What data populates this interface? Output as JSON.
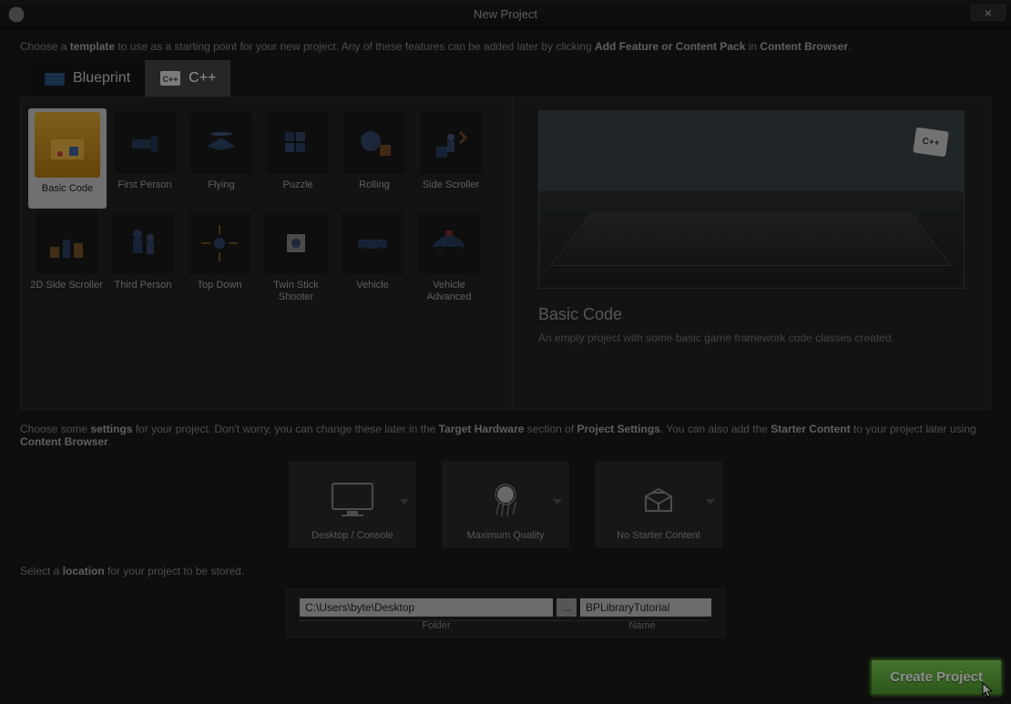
{
  "window": {
    "title": "New Project",
    "close": "×"
  },
  "hint1": {
    "prefix": "Choose a ",
    "bold1": "template",
    "mid": " to use as a starting point for your new project.  Any of these features can be added later by clicking ",
    "bold2": "Add Feature or Content Pack",
    "mid2": " in ",
    "bold3": "Content Browser",
    "end": "."
  },
  "tabs": {
    "blueprint": "Blueprint",
    "cpp": "C++"
  },
  "templates": [
    {
      "label": "Basic Code",
      "selected": true
    },
    {
      "label": "First Person"
    },
    {
      "label": "Flying"
    },
    {
      "label": "Puzzle"
    },
    {
      "label": "Rolling"
    },
    {
      "label": "Side Scroller"
    },
    {
      "label": "2D Side Scroller"
    },
    {
      "label": "Third Person"
    },
    {
      "label": "Top Down"
    },
    {
      "label": "Twin Stick Shooter"
    },
    {
      "label": "Vehicle"
    },
    {
      "label": "Vehicle Advanced"
    }
  ],
  "preview": {
    "title": "Basic Code",
    "desc": "An empty project with some basic game framework code classes created.",
    "badge": "C++"
  },
  "hint2": {
    "prefix": "Choose some ",
    "bold1": "settings",
    "mid": " for your project.  Don't worry, you can change these later in the ",
    "bold2": "Target Hardware",
    "mid2": " section of ",
    "bold3": "Project Settings",
    "mid3": ".  You can also add the ",
    "bold4": "Starter Content",
    "mid4": " to your project later using ",
    "bold5": "Content Browser",
    "end": "."
  },
  "settings": {
    "hardware": "Desktop / Console",
    "quality": "Maximum Quality",
    "starter": "No Starter Content"
  },
  "hint3": {
    "prefix": "Select a ",
    "bold1": "location",
    "end": " for your project to be stored."
  },
  "location": {
    "folder": "C:\\Users\\byte\\Desktop",
    "browse": "...",
    "name": "BPLibraryTutorial",
    "folder_label": "Folder",
    "name_label": "Name"
  },
  "create": "Create Project"
}
